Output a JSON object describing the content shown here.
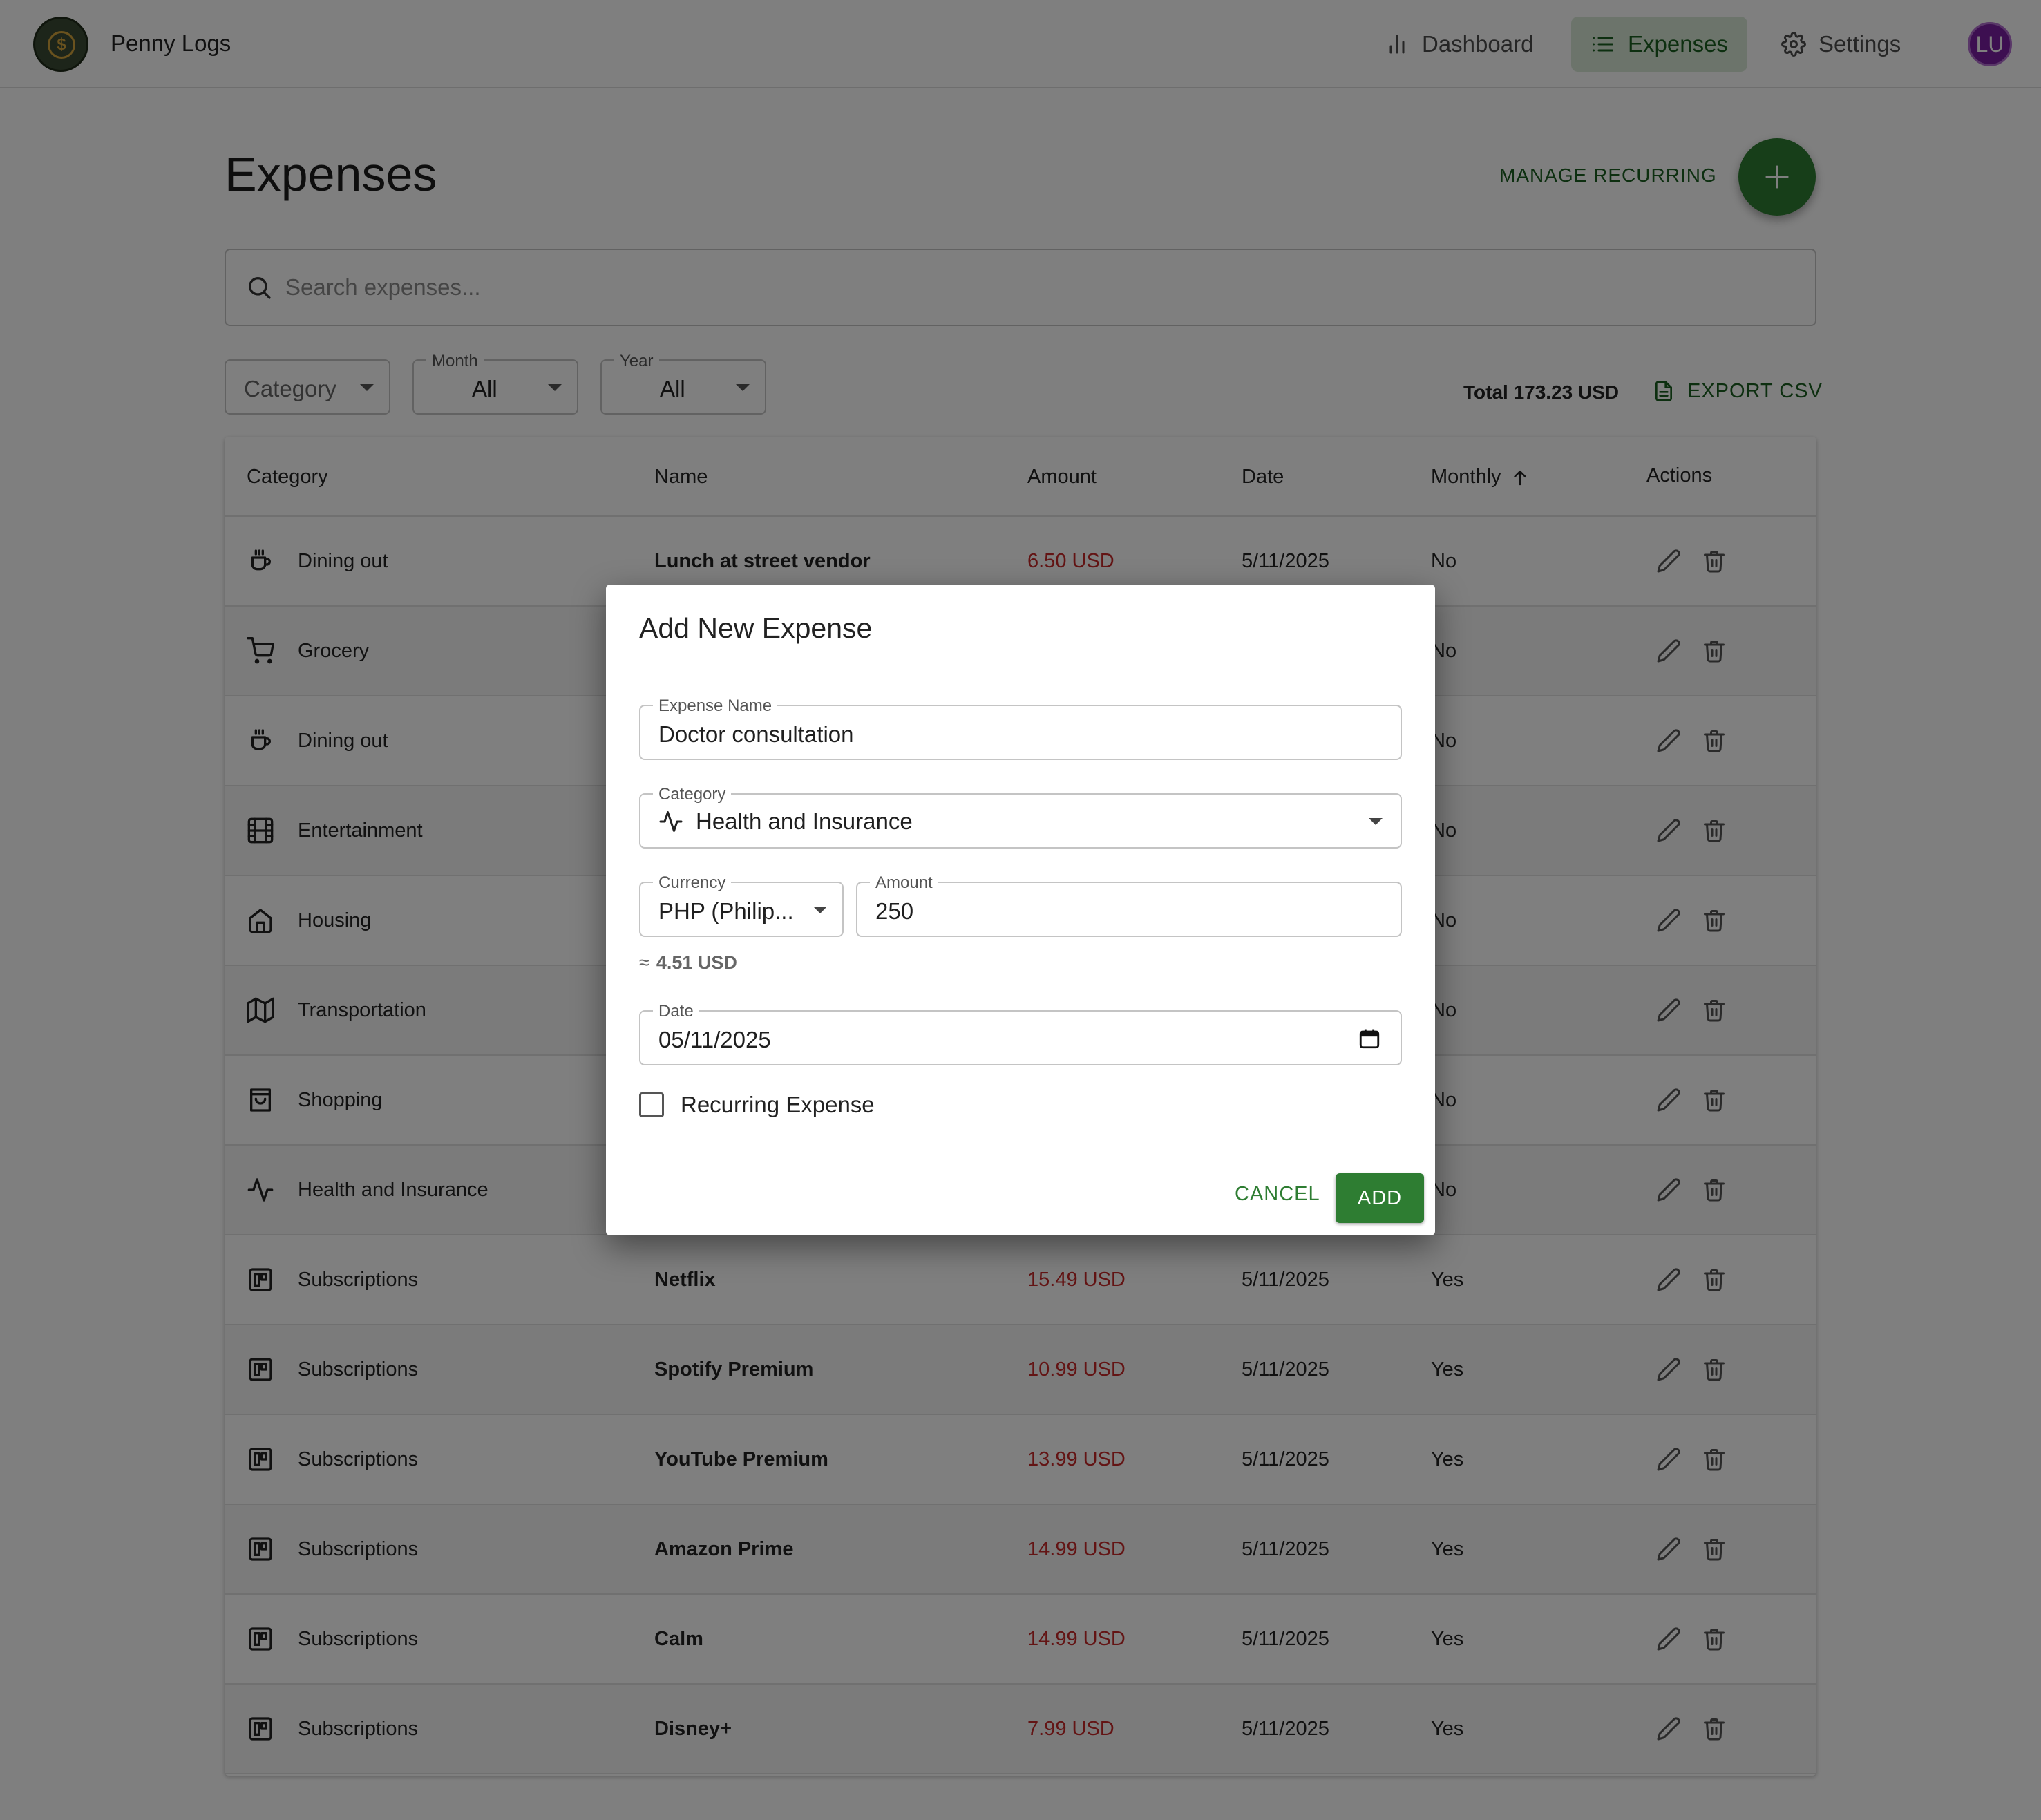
{
  "app": {
    "name": "Penny Logs",
    "user_initials": "LU"
  },
  "nav": {
    "items": [
      {
        "label": "Dashboard",
        "icon": "bar-chart-icon",
        "active": false
      },
      {
        "label": "Expenses",
        "icon": "list-icon",
        "active": true
      },
      {
        "label": "Settings",
        "icon": "gear-icon",
        "active": false
      }
    ]
  },
  "page": {
    "title": "Expenses",
    "manage_recurring_label": "MANAGE RECURRING",
    "search_placeholder": "Search expenses...",
    "filters": {
      "category_label": "Category",
      "month_label": "Month",
      "month_value": "All",
      "year_label": "Year",
      "year_value": "All"
    },
    "total": "Total 173.23 USD",
    "export_label": "EXPORT CSV"
  },
  "table": {
    "headers": {
      "category": "Category",
      "name": "Name",
      "amount": "Amount",
      "date": "Date",
      "monthly": "Monthly",
      "actions": "Actions"
    },
    "sort": {
      "column": "Monthly",
      "direction": "ascending"
    },
    "rows": [
      {
        "category": "Dining out",
        "icon": "coffee-cup-icon",
        "name": "Lunch at street vendor",
        "amount": "6.50 USD",
        "date": "5/11/2025",
        "monthly": "No"
      },
      {
        "category": "Grocery",
        "icon": "shopping-cart-icon",
        "name": "",
        "amount": "",
        "date": "",
        "monthly": "No"
      },
      {
        "category": "Dining out",
        "icon": "coffee-cup-icon",
        "name": "",
        "amount": "",
        "date": "",
        "monthly": "No"
      },
      {
        "category": "Entertainment",
        "icon": "film-icon",
        "name": "",
        "amount": "",
        "date": "",
        "monthly": "No"
      },
      {
        "category": "Housing",
        "icon": "home-icon",
        "name": "",
        "amount": "",
        "date": "",
        "monthly": "No"
      },
      {
        "category": "Transportation",
        "icon": "map-icon",
        "name": "",
        "amount": "",
        "date": "",
        "monthly": "No"
      },
      {
        "category": "Shopping",
        "icon": "shopping-bag-icon",
        "name": "",
        "amount": "",
        "date": "",
        "monthly": "No"
      },
      {
        "category": "Health and Insurance",
        "icon": "activity-icon",
        "name": "",
        "amount": "",
        "date": "",
        "monthly": "No"
      },
      {
        "category": "Subscriptions",
        "icon": "subscriptions-icon",
        "name": "Netflix",
        "amount": "15.49 USD",
        "date": "5/11/2025",
        "monthly": "Yes"
      },
      {
        "category": "Subscriptions",
        "icon": "subscriptions-icon",
        "name": "Spotify Premium",
        "amount": "10.99 USD",
        "date": "5/11/2025",
        "monthly": "Yes"
      },
      {
        "category": "Subscriptions",
        "icon": "subscriptions-icon",
        "name": "YouTube Premium",
        "amount": "13.99 USD",
        "date": "5/11/2025",
        "monthly": "Yes"
      },
      {
        "category": "Subscriptions",
        "icon": "subscriptions-icon",
        "name": "Amazon Prime",
        "amount": "14.99 USD",
        "date": "5/11/2025",
        "monthly": "Yes"
      },
      {
        "category": "Subscriptions",
        "icon": "subscriptions-icon",
        "name": "Calm",
        "amount": "14.99 USD",
        "date": "5/11/2025",
        "monthly": "Yes"
      },
      {
        "category": "Subscriptions",
        "icon": "subscriptions-icon",
        "name": "Disney+",
        "amount": "7.99 USD",
        "date": "5/11/2025",
        "monthly": "Yes"
      }
    ]
  },
  "dialog": {
    "title": "Add New Expense",
    "expense_name_label": "Expense Name",
    "expense_name_value": "Doctor consultation",
    "category_label": "Category",
    "category_value": "Health and Insurance",
    "currency_label": "Currency",
    "currency_value": "PHP (Philip...",
    "amount_label": "Amount",
    "amount_value": "250",
    "approx_symbol": "≈",
    "approx_value": "4.51 USD",
    "date_label": "Date",
    "date_value": "05/11/2025",
    "recurring_label": "Recurring Expense",
    "recurring_checked": false,
    "cancel_label": "CANCEL",
    "add_label": "ADD"
  },
  "colors": {
    "primary": "#2e7d32",
    "primary_text": "#1b5e20",
    "active_nav_bg": "#d8e8d6",
    "amount_red": "#c62828",
    "avatar": "#7b1fa2"
  }
}
